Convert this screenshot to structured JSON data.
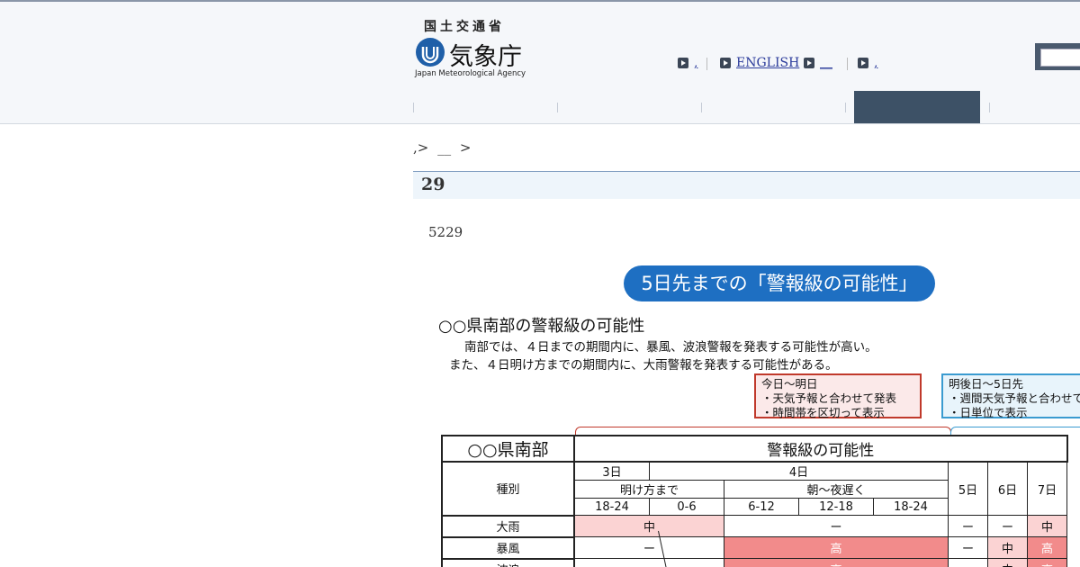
{
  "header": {
    "ministry": "国土交通省",
    "agency": "気象庁",
    "agency_en": "Japan Meteorological Agency",
    "top_links": [
      {
        "label": ","
      },
      {
        "label": "ENGLISH"
      },
      {
        "label": "__"
      },
      {
        "label": ","
      }
    ]
  },
  "breadcrumb": {
    "items": [
      ",>",
      "__",
      ">"
    ]
  },
  "page": {
    "title": "29",
    "lead": "5229"
  },
  "figure": {
    "pill": "5日先までの「警報級の可能性」",
    "title": "○○県南部の警報級の可能性",
    "desc1": "南部では、４日までの期間内に、暴風、波浪警報を発表する可能性が高い。",
    "desc2": "また、４日明け方までの期間内に、大雨警報を発表する可能性がある。",
    "callout_red": [
      "今日～明日",
      "・天気予報と合わせて発表",
      "・時間帯を区切って表示"
    ],
    "callout_blue": [
      "明後日～5日先",
      "・週間天気予報と合わせて",
      "・日単位で表示"
    ],
    "table": {
      "region": "○○県南部",
      "header_main": "警報級の可能性",
      "type_label": "種別",
      "day3": "3日",
      "day4": "4日",
      "dawn": "明け方まで",
      "morning_late": "朝～夜遅く",
      "times": [
        "18-24",
        "0-6",
        "6-12",
        "12-18",
        "18-24"
      ],
      "days": [
        "5日",
        "6日",
        "7日"
      ],
      "rows": [
        {
          "name": "大雨",
          "a": "中",
          "b": "ー",
          "d5": "ー",
          "d6": "ー",
          "d7": "中"
        },
        {
          "name": "暴風",
          "a": "ー",
          "b": "高",
          "d5": "ー",
          "d6": "中",
          "d7": "高"
        },
        {
          "name": "波浪",
          "a": "",
          "b": "高",
          "d5": "",
          "d6": "中",
          "d7": "高"
        }
      ]
    }
  },
  "colors": {
    "nav_active": "#3d5166",
    "pill": "#1e6fc2",
    "high": "#f28b8b",
    "mid": "#fbd3d3"
  }
}
